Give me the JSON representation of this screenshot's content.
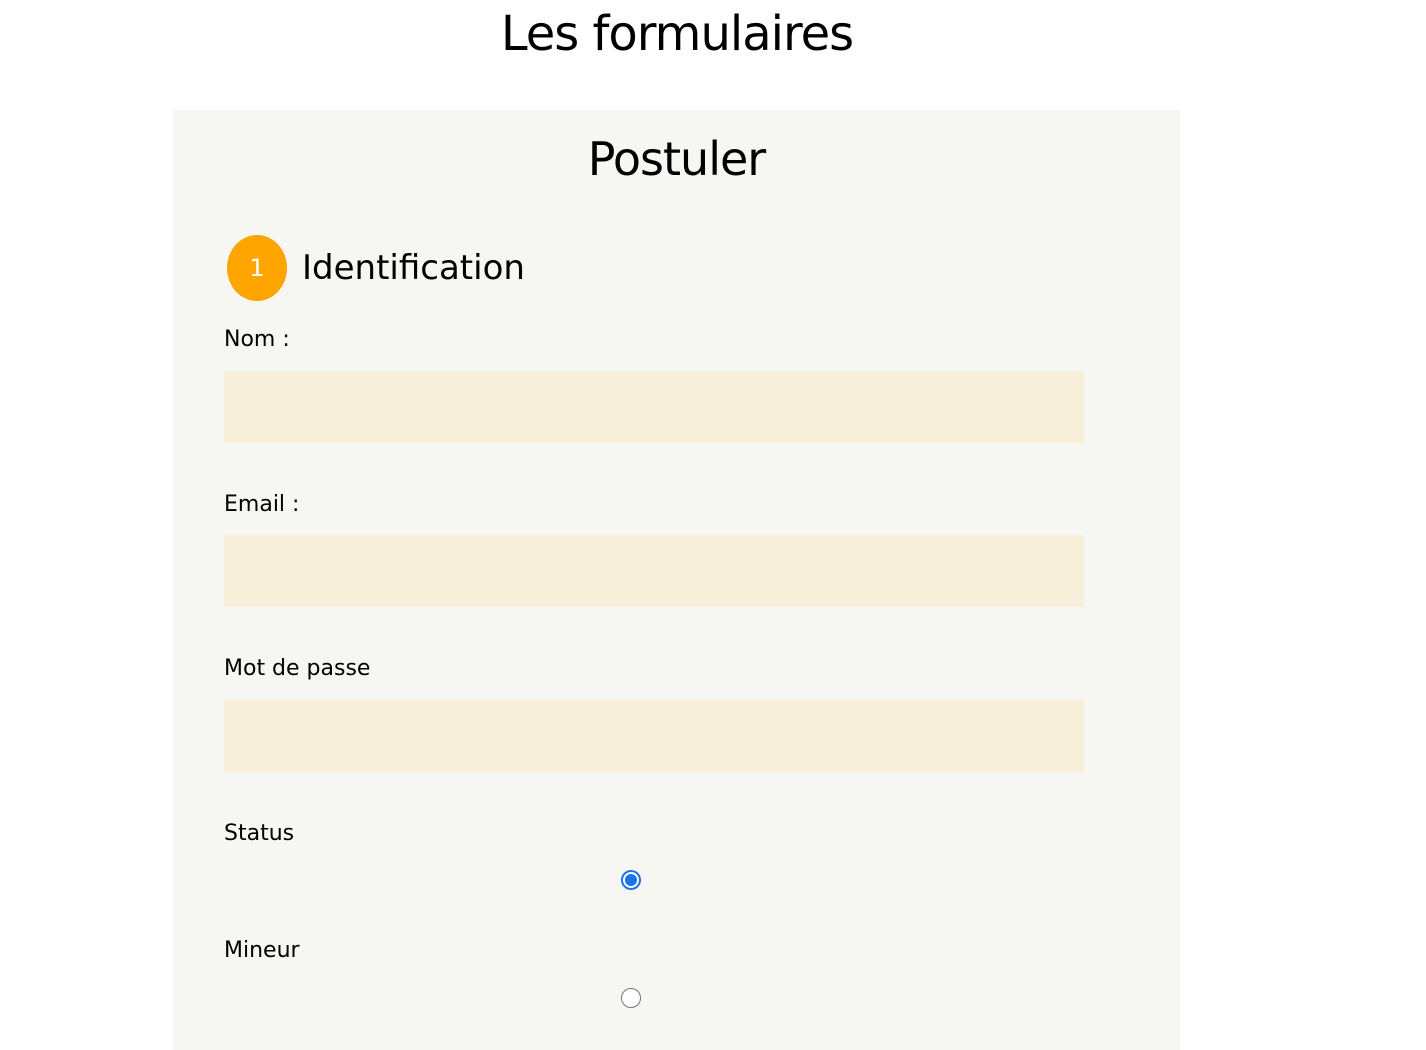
{
  "page": {
    "title": "Les formulaires"
  },
  "form": {
    "title": "Postuler",
    "step": {
      "number": "1",
      "title": "Identification"
    },
    "fields": {
      "nom": {
        "label": "Nom :",
        "value": "",
        "placeholder": ""
      },
      "email": {
        "label": "Email :",
        "value": "",
        "placeholder": ""
      },
      "password": {
        "label": "Mot de passe",
        "value": "",
        "placeholder": ""
      }
    },
    "radios": {
      "status": {
        "label": "Status",
        "checked": true
      },
      "mineur": {
        "label": "Mineur",
        "checked": false
      }
    }
  },
  "colors": {
    "panel_bg": "#f6f6f2",
    "input_bg": "#f8efdb",
    "step_badge": "#ffa500",
    "radio_accent": "#1a73e8"
  }
}
